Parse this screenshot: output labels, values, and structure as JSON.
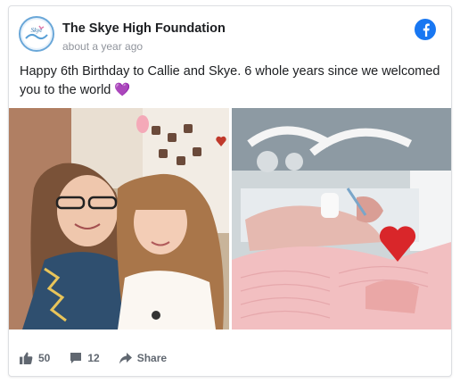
{
  "post": {
    "page_name": "The Skye High Foundation",
    "timestamp": "about a year ago",
    "text": "Happy 6th Birthday to Callie and Skye. 6 whole years since we welcomed you to the world 💜",
    "avatar_logo_text": "Skye High"
  },
  "actions": {
    "likes": "50",
    "comments": "12",
    "share_label": "Share"
  },
  "icons": {
    "brand": "facebook-icon",
    "like": "thumbs-up-icon",
    "comment": "comment-icon",
    "share": "share-arrow-icon"
  },
  "colors": {
    "facebook_blue": "#1877f2",
    "meta_text": "#90949c",
    "action_text": "#606770"
  }
}
